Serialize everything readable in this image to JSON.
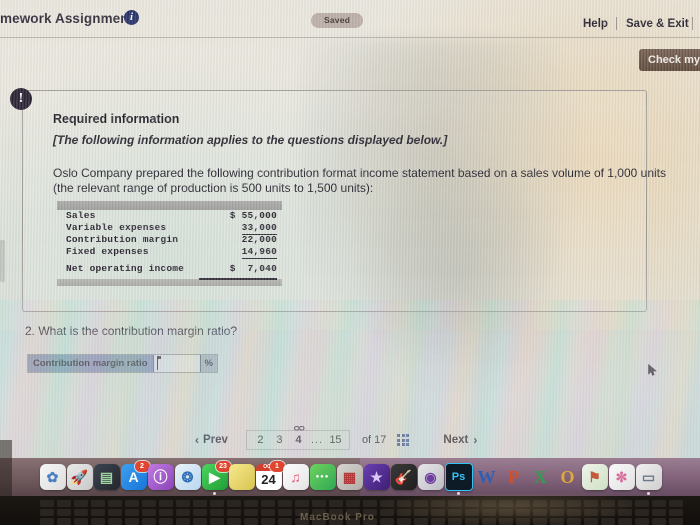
{
  "header": {
    "title": "mework Assignment",
    "info_icon": "info-icon",
    "saved_label": "Saved",
    "help_label": "Help",
    "save_exit_label": "Save & Exit",
    "check_button_label": "Check my work"
  },
  "panel": {
    "alert_icon": "!",
    "title": "Required information",
    "italic_note": "[The following information applies to the questions displayed below.]",
    "paragraph_line1": "Oslo Company prepared the following contribution format income statement based on a sales volume of 1,000 units",
    "paragraph_line2": "(the relevant range of production is 500 units to 1,500 units):"
  },
  "statement": {
    "rows": [
      {
        "label": "Sales",
        "amount": "$ 55,000",
        "underline": false
      },
      {
        "label": "Variable expenses",
        "amount": "33,000",
        "underline": true
      },
      {
        "label": "Contribution margin",
        "amount": "22,000",
        "underline": false
      },
      {
        "label": "Fixed expenses",
        "amount": "14,960",
        "underline": true
      },
      {
        "label": "Net operating income",
        "amount": "$  7,040",
        "underline": false
      }
    ]
  },
  "question": {
    "number_text": "2. What is the contribution margin ratio?",
    "answer_label": "Contribution margin ratio",
    "answer_value": "",
    "answer_suffix": "%"
  },
  "pagination": {
    "prev_label": "Prev",
    "prev_icon": "chevron-left-icon",
    "pages": [
      "2",
      "3",
      "4"
    ],
    "current_page": "4",
    "link_icon": "link-icon",
    "ellipsis": "...",
    "last_page": "15",
    "of_label": "of 17",
    "grid_icon": "grid-icon",
    "next_label": "Next",
    "next_icon": "chevron-right-icon"
  },
  "dock": {
    "items": [
      {
        "name": "photos-icon",
        "glyph": "✿",
        "bg": "linear-gradient(135deg,#f7f7f7,#dcdcdc)",
        "color": "#4a7fc1",
        "badge": "",
        "running": false
      },
      {
        "name": "launchpad-icon",
        "glyph": "🚀",
        "bg": "linear-gradient(135deg,#e8e8e8,#c9c9c9)",
        "color": "#5a5a5a",
        "badge": "",
        "running": false
      },
      {
        "name": "mission-control-icon",
        "glyph": "▤",
        "bg": "linear-gradient(135deg,#3b4450,#23272e)",
        "color": "#9fd4a0",
        "badge": "",
        "running": false
      },
      {
        "name": "app-store-icon",
        "glyph": "A",
        "bg": "linear-gradient(135deg,#3ea0f0,#1775d8)",
        "color": "#ffffff",
        "badge": "2",
        "running": false
      },
      {
        "name": "podcasts-icon",
        "glyph": "ⓘ",
        "bg": "linear-gradient(135deg,#c07ae0,#8a45b8)",
        "color": "#ffffff",
        "badge": "",
        "running": false
      },
      {
        "name": "safari-icon",
        "glyph": "❂",
        "bg": "linear-gradient(135deg,#e9f2fa,#b9d6ee)",
        "color": "#2f6fb5",
        "badge": "",
        "running": false
      },
      {
        "name": "facetime-icon",
        "glyph": "▶",
        "bg": "linear-gradient(135deg,#4cd45f,#1f9e34)",
        "color": "#ffffff",
        "badge": "23",
        "running": true
      },
      {
        "name": "notes-icon",
        "glyph": "",
        "bg": "linear-gradient(135deg,#f6e98d,#d8c450)",
        "color": "#7a6a20",
        "badge": "",
        "running": false
      },
      {
        "name": "calendar-icon",
        "glyph": "24",
        "bg": "#ffffff",
        "color": "#2b2b2b",
        "badge": "1",
        "running": false
      },
      {
        "name": "music-icon",
        "glyph": "♫",
        "bg": "linear-gradient(135deg,#fdfdfd,#e4e4e4)",
        "color": "#e85a7a",
        "badge": "",
        "running": false
      },
      {
        "name": "messages-icon",
        "glyph": "●●●",
        "bg": "linear-gradient(135deg,#6fd25f,#2fa855)",
        "color": "#ffffff",
        "badge": "",
        "running": false
      },
      {
        "name": "photo-booth-icon",
        "glyph": "▦",
        "bg": "linear-gradient(135deg,#d8d4cf,#b0aca6)",
        "color": "#b23a3a",
        "badge": "",
        "running": false
      },
      {
        "name": "imovie-icon",
        "glyph": "★",
        "bg": "linear-gradient(135deg,#6a3fb0,#3d1f74)",
        "color": "#d9c6f5",
        "badge": "",
        "running": false
      },
      {
        "name": "garageband-icon",
        "glyph": "🎸",
        "bg": "linear-gradient(135deg,#3a3a3a,#1e1e1e)",
        "color": "#e0a457",
        "badge": "",
        "running": false
      },
      {
        "name": "disc-app-icon",
        "glyph": "◉",
        "bg": "linear-gradient(135deg,#e7e7ea,#bcbcc4)",
        "color": "#6e3f9e",
        "badge": "",
        "running": false
      },
      {
        "name": "photoshop-icon",
        "glyph": "Ps",
        "bg": "#0d1b26",
        "color": "#35c2f5",
        "badge": "",
        "running": true
      },
      {
        "name": "word-icon",
        "glyph": "W",
        "bg": "transparent",
        "color": "#2b5fb8",
        "badge": "",
        "running": false
      },
      {
        "name": "powerpoint-icon",
        "glyph": "P",
        "bg": "transparent",
        "color": "#d1502a",
        "badge": "",
        "running": false
      },
      {
        "name": "excel-icon",
        "glyph": "X",
        "bg": "transparent",
        "color": "#2f9e50",
        "badge": "",
        "running": false
      },
      {
        "name": "outlook-icon",
        "glyph": "O",
        "bg": "transparent",
        "color": "#e0a93a",
        "badge": "",
        "running": false
      },
      {
        "name": "maps-icon",
        "glyph": "⚑",
        "bg": "linear-gradient(135deg,#eef3e8,#cfe0c6)",
        "color": "#c05a3a",
        "badge": "",
        "running": false
      },
      {
        "name": "photos-app-icon",
        "glyph": "✼",
        "bg": "linear-gradient(135deg,#fafafa,#e0e0e0)",
        "color": "#d86a9a",
        "badge": "",
        "running": false
      },
      {
        "name": "preview-icon",
        "glyph": "▭",
        "bg": "linear-gradient(135deg,#f0f0f0,#cfcfcf)",
        "color": "#6a7a8a",
        "badge": "",
        "running": true
      }
    ]
  },
  "laptop": {
    "brand_text": "MacBook Pro"
  },
  "colors": {
    "accent_blue": "#3b4c86",
    "check_button": "#5b4638",
    "answer_label_bg": "#7e93ad",
    "badge_red": "#e0452f"
  }
}
